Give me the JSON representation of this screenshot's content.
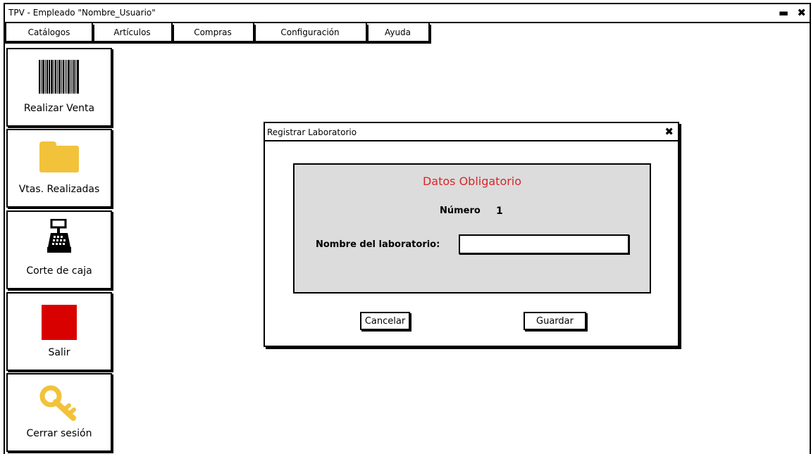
{
  "window": {
    "title": "TPV - Empleado \"Nombre_Usuario\"",
    "minimize_glyph": "▬",
    "close_glyph": "✖"
  },
  "menu": {
    "items": [
      {
        "label": "Catálogos"
      },
      {
        "label": "Artículos"
      },
      {
        "label": "Compras"
      },
      {
        "label": "Configuración"
      },
      {
        "label": "Ayuda"
      }
    ]
  },
  "sidebar": {
    "items": [
      {
        "label": "Realizar Venta",
        "icon": "barcode-icon"
      },
      {
        "label": "Vtas. Realizadas",
        "icon": "folder-icon"
      },
      {
        "label": "Corte de caja",
        "icon": "cash-register-icon"
      },
      {
        "label": "Salir",
        "icon": "stop-square-icon"
      },
      {
        "label": "Cerrar sesión",
        "icon": "key-icon"
      }
    ]
  },
  "dialog": {
    "title": "Registrar Laboratorio",
    "close_glyph": "✖",
    "panel_heading": "Datos Obligatorio",
    "numero_label": "Número",
    "numero_value": "1",
    "nombre_label": "Nombre del laboratorio:",
    "nombre_value": "",
    "cancel_label": "Cancelar",
    "save_label": "Guardar"
  },
  "colors": {
    "heading_red": "#d6262c",
    "folder_yellow": "#f2c23b",
    "exit_red": "#d90000",
    "panel_gray": "#dcdcdc"
  }
}
